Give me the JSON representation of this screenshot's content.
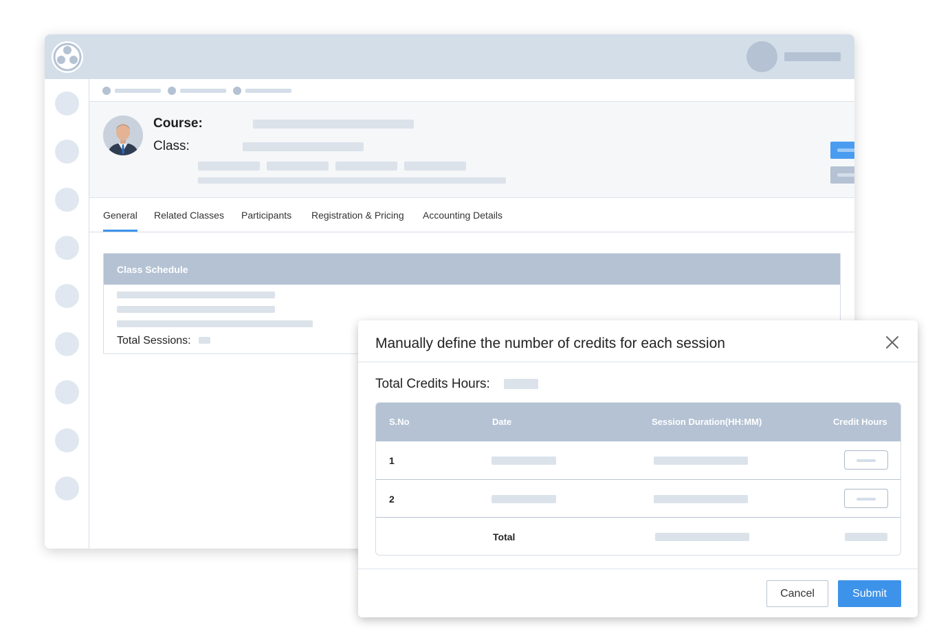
{
  "app": {
    "header": {
      "course_label": "Course:",
      "class_label": "Class:"
    },
    "tabs": [
      {
        "label": "General",
        "active": true
      },
      {
        "label": "Related Classes",
        "active": false
      },
      {
        "label": "Participants",
        "active": false
      },
      {
        "label": "Registration & Pricing",
        "active": false
      },
      {
        "label": "Accounting Details",
        "active": false
      }
    ],
    "class_schedule": {
      "title": "Class Schedule",
      "total_sessions_label": "Total Sessions:"
    }
  },
  "modal": {
    "title": "Manually define the number of credits for each session",
    "total_credits_label": "Total Credits Hours:",
    "table": {
      "columns": [
        "S.No",
        "Date",
        "Session Duration(HH:MM)",
        "Credit Hours"
      ],
      "rows": [
        {
          "sno": "1"
        },
        {
          "sno": "2"
        }
      ],
      "total_label": "Total"
    },
    "cancel_label": "Cancel",
    "submit_label": "Submit"
  },
  "colors": {
    "accent": "#3d93ea",
    "topbar": "#d3dee9",
    "table_header": "#b4c2d3"
  },
  "icons": [
    "logo-icon",
    "close-icon"
  ]
}
